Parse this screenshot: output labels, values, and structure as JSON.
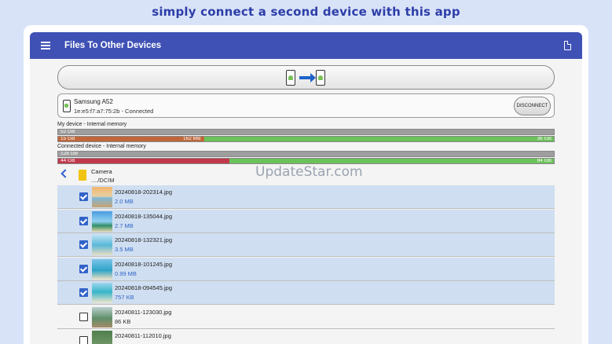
{
  "headline": "simply connect a second device with this app",
  "appbar": {
    "title": "Files To Other Devices"
  },
  "device": {
    "name": "Samsung A52",
    "info": "1e:e5:f7:a7:75:2b - Connected",
    "disconnect_label": "DISCONNECT"
  },
  "my_device": {
    "label": "My device - Internal memory",
    "total": "52 GB",
    "used": "15 GB",
    "selected": "162 MB",
    "free": "36 GB",
    "used_fraction": 0.295,
    "free_fraction": 0.705
  },
  "connected_device": {
    "label": "Connected device - Internal memory",
    "total": "128 GB",
    "used": "44 GB",
    "free": "84 GB",
    "used_fraction": 0.345,
    "free_fraction": 0.655
  },
  "watermark": "UpdateStar.com",
  "folder": {
    "name": "Camera",
    "path": "..../DCIM"
  },
  "files": [
    {
      "name": "20240818-202314.jpg",
      "size": "2.0 MB",
      "selected": true
    },
    {
      "name": "20240818-135044.jpg",
      "size": "2.7 MB",
      "selected": true
    },
    {
      "name": "20240818-132321.jpg",
      "size": "3.5 MB",
      "selected": true
    },
    {
      "name": "20240818-101245.jpg",
      "size": "0.99 MB",
      "selected": true
    },
    {
      "name": "20240818-094545.jpg",
      "size": "757 KB",
      "selected": true
    },
    {
      "name": "20240811-123030.jpg",
      "size": "86 KB",
      "selected": false
    },
    {
      "name": "20240811-112010.jpg",
      "size": "",
      "selected": false
    }
  ],
  "colors": {
    "accent": "#3f51b5",
    "used_bar": "#c0673a",
    "used_bar_connected": "#c0394a",
    "free_bar": "#6cc25a",
    "total_bar": "#9e9e9e",
    "selected_row": "#cfdff1"
  }
}
